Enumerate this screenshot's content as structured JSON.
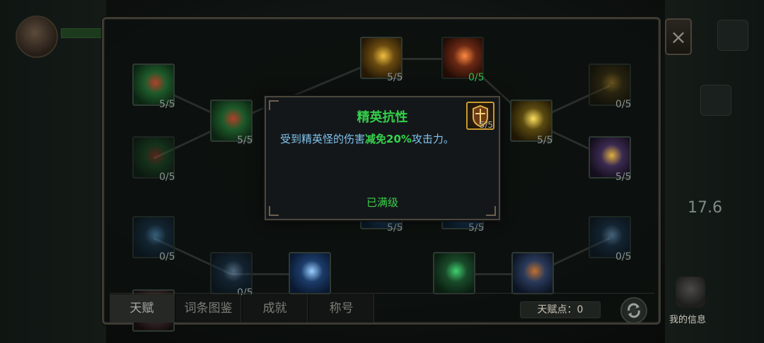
{
  "tooltip": {
    "title": "精英抗性",
    "desc_prefix": "受到精英怪的伤害",
    "desc_highlight": "减免20%",
    "desc_suffix": "攻击力。",
    "status": "已满级",
    "icon_count": "5/5"
  },
  "nodes": [
    {
      "count": "5/5",
      "state": "maxed",
      "icon": "crossbow-icon"
    },
    {
      "count": "0/5",
      "state": "locked",
      "icon": "crossbow-icon"
    },
    {
      "count": "0/5",
      "state": "locked",
      "icon": "ice-shard-icon"
    },
    {
      "count": "5/5",
      "state": "maxed",
      "icon": "crossbow-icon"
    },
    {
      "count": "5/5",
      "state": "maxed",
      "icon": "gold-shield-icon"
    },
    {
      "count": "0/5",
      "state": "available",
      "icon": "fire-arrow-icon"
    },
    {
      "count": "5/5",
      "state": "maxed",
      "icon": "lightning-shield-icon"
    },
    {
      "count": "0/5",
      "state": "locked",
      "icon": "emblem-icon"
    },
    {
      "count": "5/5",
      "state": "maxed",
      "icon": "spiked-shield-icon"
    },
    {
      "count": "5/5",
      "state": "maxed",
      "icon": "node-icon"
    },
    {
      "count": "5/5",
      "state": "maxed",
      "icon": "node-icon"
    },
    {
      "count": "0/5",
      "state": "locked",
      "icon": "frost-arrow-icon"
    },
    {
      "count": "0/5",
      "state": "locked",
      "icon": "ring-icon"
    },
    {
      "count": "",
      "state": "maxed",
      "icon": "blade-icon"
    },
    {
      "count": "",
      "state": "maxed",
      "icon": "poison-icon"
    },
    {
      "count": "",
      "state": "maxed",
      "icon": "boot-icon"
    },
    {
      "count": "",
      "state": "maxed",
      "icon": "fire-orb-icon"
    }
  ],
  "tabs": [
    "天赋",
    "词条图鉴",
    "成就",
    "称号"
  ],
  "points_label": "天赋点：0",
  "close_glyph": "×",
  "side": {
    "stat": "17.6",
    "my_info": "我的信息"
  }
}
